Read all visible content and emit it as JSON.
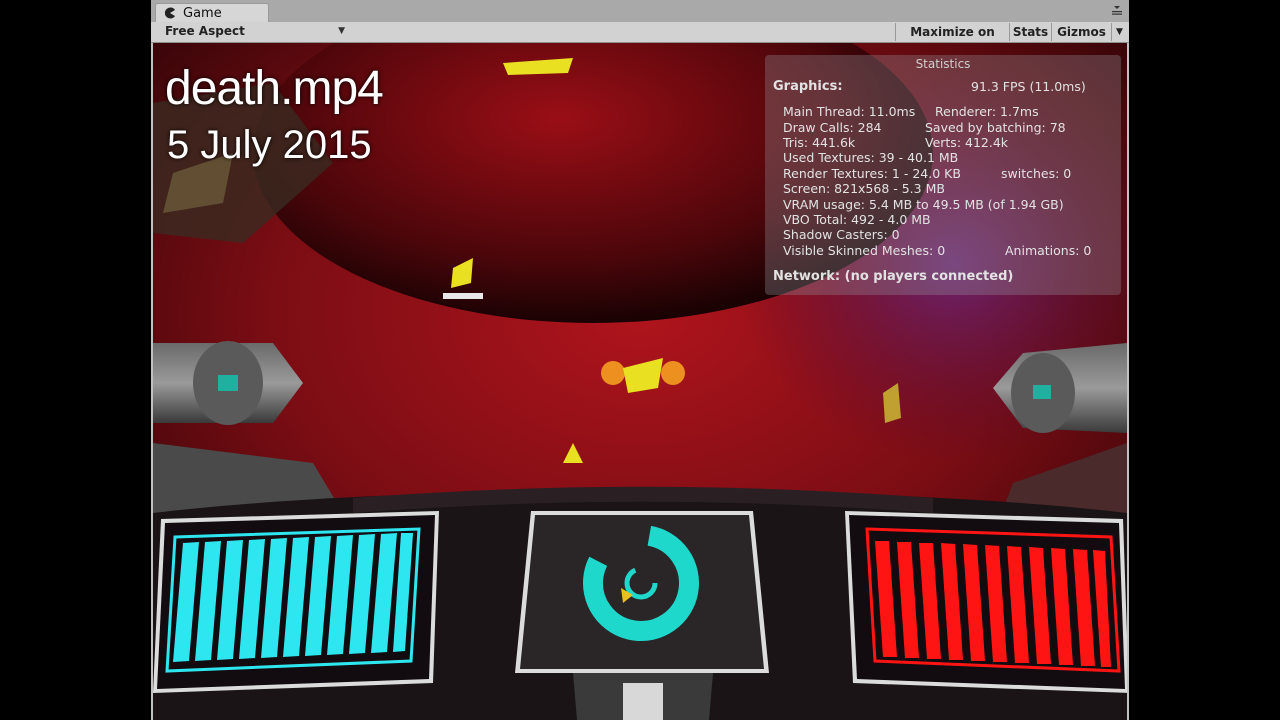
{
  "window": {
    "tab_label": "Game",
    "aspect_label": "Free Aspect",
    "toolbar": {
      "maximize_label": "Maximize on Play",
      "stats_label": "Stats",
      "gizmos_label": "Gizmos"
    }
  },
  "overlay": {
    "title": "death.mp4",
    "date": "5 July 2015"
  },
  "statistics": {
    "header": "Statistics",
    "graphics_label": "Graphics:",
    "fps": "91.3 FPS (11.0ms)",
    "main_thread": "Main Thread: 11.0ms",
    "renderer": "Renderer: 1.7ms",
    "draw_calls": "Draw Calls: 284",
    "saved_batching": "Saved by batching: 78",
    "tris": "Tris: 441.6k",
    "verts": "Verts: 412.4k",
    "used_textures": "Used Textures: 39 - 40.1 MB",
    "render_textures": "Render Textures: 1 - 24.0 KB",
    "switches": "switches: 0",
    "screen": "Screen: 821x568 - 5.3 MB",
    "vram": "VRAM usage: 5.4 MB to 49.5 MB (of 1.94 GB)",
    "vbo": "VBO Total: 492 - 4.0 MB",
    "shadow_casters": "Shadow Casters: 0",
    "skinned_meshes": "Visible Skinned Meshes: 0",
    "animations": "Animations: 0",
    "network": "Network: (no players connected)"
  },
  "colors": {
    "left_panel": "#2ee6ef",
    "right_panel": "#ff1414",
    "radar": "#1fd8cc",
    "space": "#7a0d14"
  }
}
